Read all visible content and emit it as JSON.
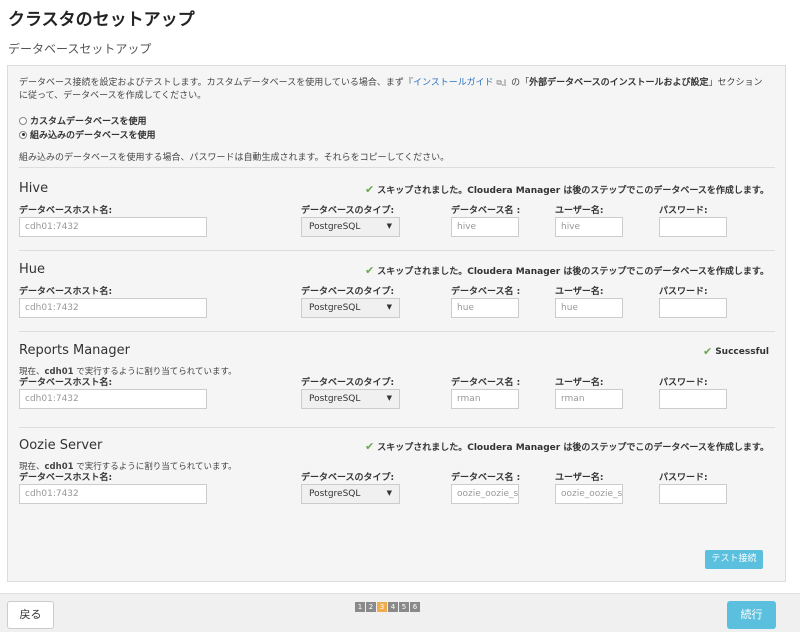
{
  "page": {
    "title": "クラスタのセットアップ",
    "section": "データベースセットアップ"
  },
  "intro": {
    "part1": "データベース接続を設定およびテストします。カスタムデータベースを使用している場合、まず『",
    "link": "インストールガイド",
    "part2": "』の「",
    "bold": "外部データベースのインストールおよび設定",
    "part3": "」セクションに従って、データベースを作成してください。"
  },
  "options": {
    "custom": "カスタムデータベースを使用",
    "embedded": "組み込みのデータベースを使用",
    "note": "組み込みのデータベースを使用する場合、パスワードは自動生成されます。それらをコピーしてください。"
  },
  "labels": {
    "host": "データベースホスト名:",
    "type": "データベースのタイプ:",
    "dbname": "データベース名 :",
    "user": "ユーザー名:",
    "password": "パスワード:"
  },
  "databases": [
    {
      "name": "Hive",
      "status": "スキップされました。Cloudera Manager は後のステップでこのデータベースを作成します。",
      "assign_prefix": "",
      "assign_host": "",
      "assign_suffix": "",
      "host": "cdh01:7432",
      "type": "PostgreSQL",
      "dbname": "hive",
      "user": "hive",
      "password": ""
    },
    {
      "name": "Hue",
      "status": "スキップされました。Cloudera Manager は後のステップでこのデータベースを作成します。",
      "assign_prefix": "",
      "assign_host": "",
      "assign_suffix": "",
      "host": "cdh01:7432",
      "type": "PostgreSQL",
      "dbname": "hue",
      "user": "hue",
      "password": ""
    },
    {
      "name": "Reports Manager",
      "status": "Successful",
      "assign_prefix": "現在、",
      "assign_host": "cdh01",
      "assign_suffix": " で実行するように割り当てられています。",
      "host": "cdh01:7432",
      "type": "PostgreSQL",
      "dbname": "rman",
      "user": "rman",
      "password": ""
    },
    {
      "name": "Oozie Server",
      "status": "スキップされました。Cloudera Manager は後のステップでこのデータベースを作成します。",
      "assign_prefix": "現在、",
      "assign_host": "cdh01",
      "assign_suffix": " で実行するように割り当てられています。",
      "host": "cdh01:7432",
      "type": "PostgreSQL",
      "dbname": "oozie_oozie_se",
      "user": "oozie_oozie_se",
      "password": ""
    }
  ],
  "buttons": {
    "test": "テスト接続",
    "back": "戻る",
    "next": "続行"
  },
  "steps": [
    "1",
    "2",
    "3",
    "4",
    "5",
    "6"
  ],
  "current_step": "3",
  "colors": {
    "accent": "#5bc0de",
    "step_active": "#f0ad4e",
    "success": "#6aa84f"
  }
}
